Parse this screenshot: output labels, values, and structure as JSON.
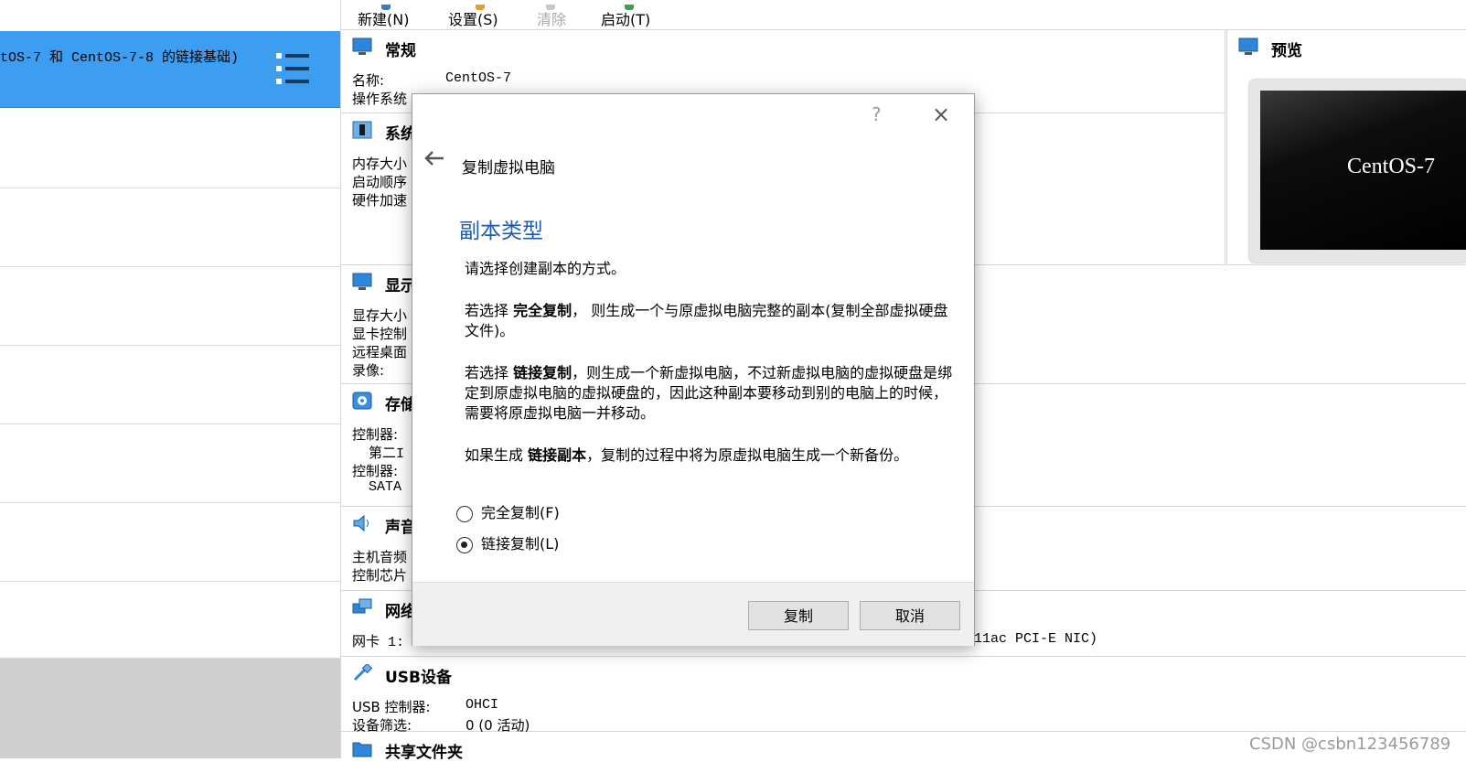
{
  "toolbar": {
    "new_label": "新建(N)",
    "settings_label": "设置(S)",
    "discard_label": "清除",
    "start_label": "启动(T)"
  },
  "vm_list": {
    "selected_name": "tOS-7 和 CentOS-7-8 的链接基础)"
  },
  "sections": {
    "general": {
      "title": "常规",
      "name_label": "名称:",
      "name_value": "CentOS-7",
      "os_label": "操作系统"
    },
    "system": {
      "title": "系统",
      "line1": "内存大小",
      "line2": "启动顺序",
      "line3": "硬件加速"
    },
    "display": {
      "title": "显示",
      "line1": "显存大小",
      "line2": "显卡控制",
      "line3": "远程桌面",
      "line4": "录像:"
    },
    "storage": {
      "title": "存储",
      "line1": "控制器:",
      "line2": "第二I",
      "line3": "控制器:",
      "line4": "SATA"
    },
    "audio": {
      "title": "声音",
      "line1": "主机音频",
      "line2": "控制芯片"
    },
    "network": {
      "title": "网络",
      "line1": "网卡 1:",
      "line1_tail": "11ac PCI-E NIC)"
    },
    "usb": {
      "title": "USB设备",
      "ctrl_label": "USB 控制器:",
      "ctrl_value": "OHCI",
      "filter_label": "设备筛选:",
      "filter_value": "0 (0 活动)"
    },
    "shared": {
      "title": "共享文件夹"
    }
  },
  "preview": {
    "title": "预览",
    "screen_text": "CentOS-7"
  },
  "dialog": {
    "help": "?",
    "close": "×",
    "heading": "复制虚拟电脑",
    "title": "副本类型",
    "intro": "请选择创建副本的方式。",
    "p1_prefix": "若选择 ",
    "p1_bold": "完全复制",
    "p1_rest": "， 则生成一个与原虚拟电脑完整的副本(复制全部虚拟硬盘文件)。",
    "p2_prefix": "若选择 ",
    "p2_bold": "链接复制",
    "p2_rest": "，则生成一个新虚拟电脑，不过新虚拟电脑的虚拟硬盘是绑定到原虚拟电脑的虚拟硬盘的，因此这种副本要移动到别的电脑上的时候，需要将原虚拟电脑一并移动。",
    "p3_prefix": "如果生成 ",
    "p3_bold": "链接副本",
    "p3_rest": "，复制的过程中将为原虚拟电脑生成一个新备份。",
    "option_full": "完全复制(F)",
    "option_linked": "链接复制(L)",
    "selected_option": "linked",
    "copy_button": "复制",
    "cancel_button": "取消"
  },
  "watermark": "CSDN @csbn123456789",
  "colors": {
    "selection": "#3d9df0",
    "title_blue": "#1f5ab0",
    "footer": "#f0f0f0"
  }
}
